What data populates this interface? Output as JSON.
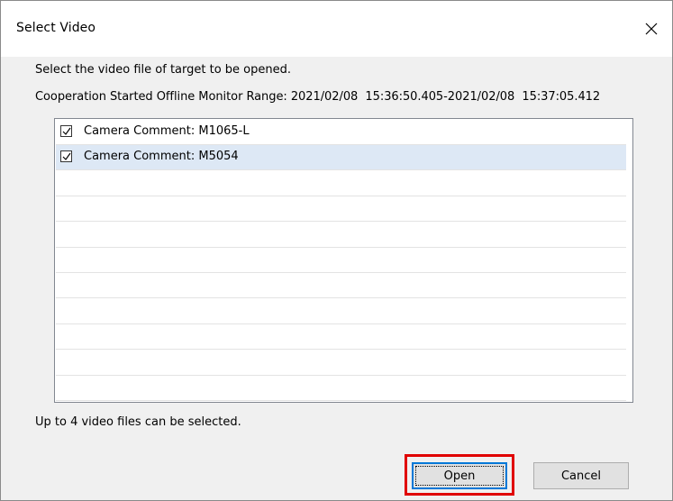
{
  "window": {
    "title": "Select Video",
    "close_icon": "close-icon"
  },
  "prompt": "Select the video file of target to be opened.",
  "range": {
    "label": "Cooperation Started Offline Monitor Range:",
    "value": "2021/02/08  15:36:50.405-2021/02/08  15:37:05.412"
  },
  "list": {
    "items": [
      {
        "label": "Camera Comment: M1065-L",
        "checked": true,
        "selected": false
      },
      {
        "label": "Camera Comment: M5054",
        "checked": true,
        "selected": true
      }
    ],
    "empty_rows": 9
  },
  "footer_note": "Up to 4 video files can be selected.",
  "buttons": {
    "open": "Open",
    "cancel": "Cancel"
  },
  "colors": {
    "highlight": "#e00000",
    "selected_row": "#dde8f5",
    "focus": "#0078d7"
  }
}
